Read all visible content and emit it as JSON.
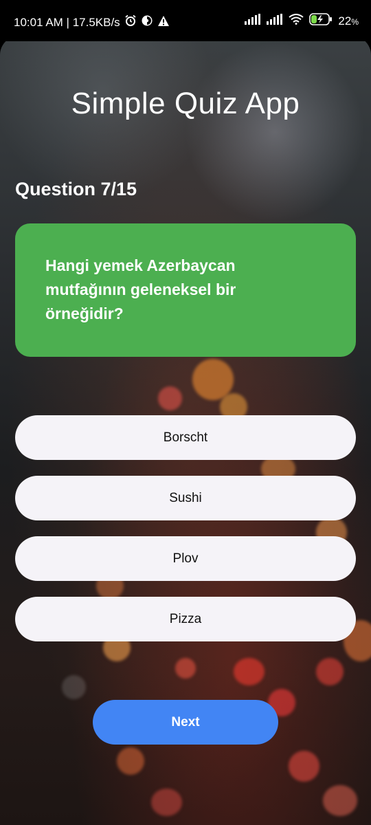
{
  "status_bar": {
    "time_speed": "10:01 AM | 17.5KB/s",
    "battery": "22",
    "battery_suffix": "%",
    "icons": [
      "alarm-icon",
      "data-saver-icon",
      "warning-icon",
      "signal-icon",
      "signal-icon",
      "wifi-icon",
      "battery-charging-icon"
    ]
  },
  "app": {
    "title": "Simple Quiz App",
    "question_counter": "Question 7/15",
    "question_text": "Hangi yemek Azerbaycan mutfağının geleneksel bir örneğidir?",
    "answers": [
      "Borscht",
      "Sushi",
      "Plov",
      "Pizza"
    ],
    "next_label": "Next"
  },
  "colors": {
    "question_card": "#4caf50",
    "answer_bg": "#f5f3f8",
    "next_button": "#4285f4"
  }
}
